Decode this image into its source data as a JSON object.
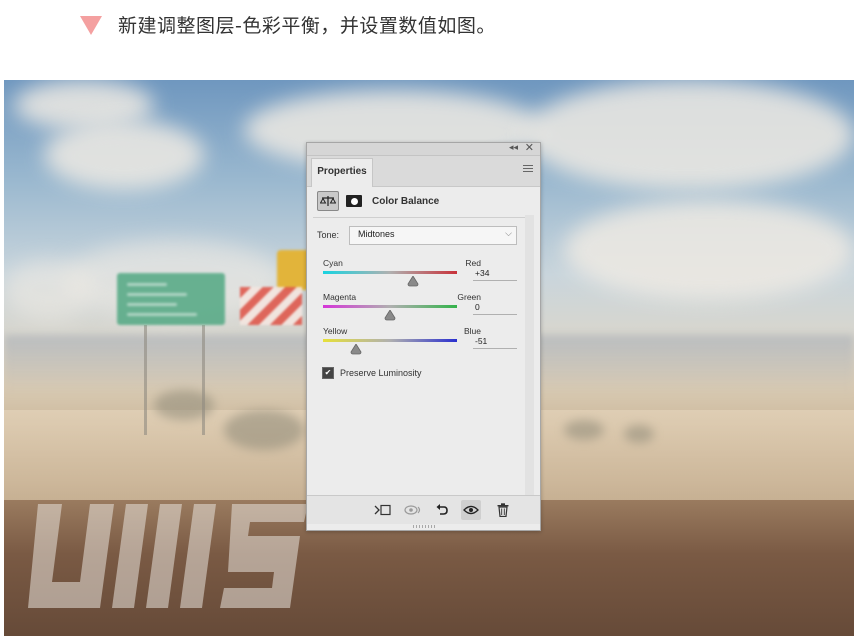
{
  "header": {
    "text": "新建调整图层-色彩平衡，并设置数值如图。",
    "marker_color": "#f4a0a0"
  },
  "panel": {
    "title_tab": "Properties",
    "collapse_icon": "double-chevron-left-icon",
    "close_icon": "close-icon",
    "adjustment_title": "Color Balance",
    "tone_label": "Tone:",
    "tone_value": "Midtones",
    "sliders": [
      {
        "left": "Cyan",
        "right": "Red",
        "value": "+34",
        "numeric": 34,
        "colors": [
          "#19d3e0",
          "#c8323a"
        ]
      },
      {
        "left": "Magenta",
        "right": "Green",
        "value": "0",
        "numeric": 0,
        "colors": [
          "#d535d8",
          "#33b24a"
        ]
      },
      {
        "left": "Yellow",
        "right": "Blue",
        "value": "-51",
        "numeric": -51,
        "colors": [
          "#e6e03a",
          "#2a2fcf"
        ]
      }
    ],
    "preserve_luminosity": {
      "label": "Preserve Luminosity",
      "checked": true
    },
    "bottom_icons": [
      "clip-to-layer-icon",
      "view-previous-state-icon",
      "reset-icon",
      "visibility-eye-icon",
      "trash-icon"
    ]
  }
}
